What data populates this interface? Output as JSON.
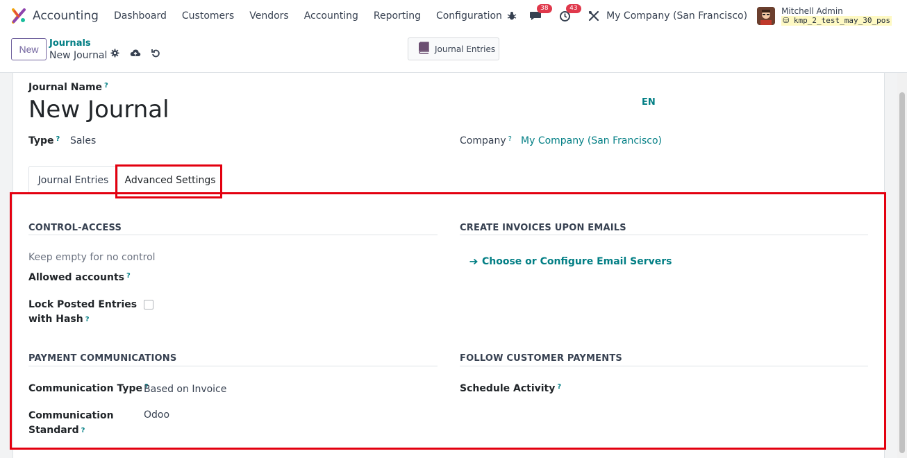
{
  "navbar": {
    "app_name": "Accounting",
    "menu": [
      "Dashboard",
      "Customers",
      "Vendors",
      "Accounting",
      "Reporting",
      "Configuration"
    ],
    "messages_count": "38",
    "activities_count": "43",
    "company": "My Company (San Francisco)",
    "user_name": "Mitchell Admin",
    "database": "kmp_2_test_may_30_pos"
  },
  "control_panel": {
    "new_label": "New",
    "breadcrumb_parent": "Journals",
    "breadcrumb_current": "New Journal",
    "smart_button_label": "Journal Entries"
  },
  "form": {
    "journal_name_label": "Journal Name",
    "journal_name_value": "New Journal",
    "lang": "EN",
    "type_label": "Type",
    "type_value": "Sales",
    "company_label": "Company",
    "company_value": "My Company (San Francisco)",
    "help_mark": "?"
  },
  "tabs": [
    "Journal Entries",
    "Advanced Settings"
  ],
  "advanced": {
    "control_access_title": "CONTROL-ACCESS",
    "allowed_accounts_placeholder": "Keep empty for no control",
    "allowed_accounts_label": "Allowed accounts",
    "lock_hash_label_line1": "Lock Posted Entries",
    "lock_hash_label_line2": "with Hash",
    "lock_hash_checked": false,
    "create_invoices_title": "CREATE INVOICES UPON EMAILS",
    "email_servers_link": "Choose or Configure Email Servers",
    "payment_comm_title": "PAYMENT COMMUNICATIONS",
    "comm_type_label": "Communication Type",
    "comm_type_value": "Based on Invoice",
    "comm_standard_label_line1": "Communication",
    "comm_standard_label_line2": "Standard",
    "comm_standard_value": "Odoo",
    "follow_payments_title": "FOLLOW CUSTOMER PAYMENTS",
    "schedule_activity_label": "Schedule Activity"
  },
  "colors": {
    "accent": "#017e84",
    "primary": "#71639e",
    "highlight": "#e3000f",
    "badge": "#e0384b"
  },
  "icons": [
    "app-logo-icon",
    "bug-icon",
    "chat-icon",
    "clock-icon",
    "tools-icon",
    "database-icon",
    "gear-icon",
    "cloud-upload-icon",
    "undo-icon",
    "book-icon",
    "arrow-right-icon"
  ]
}
